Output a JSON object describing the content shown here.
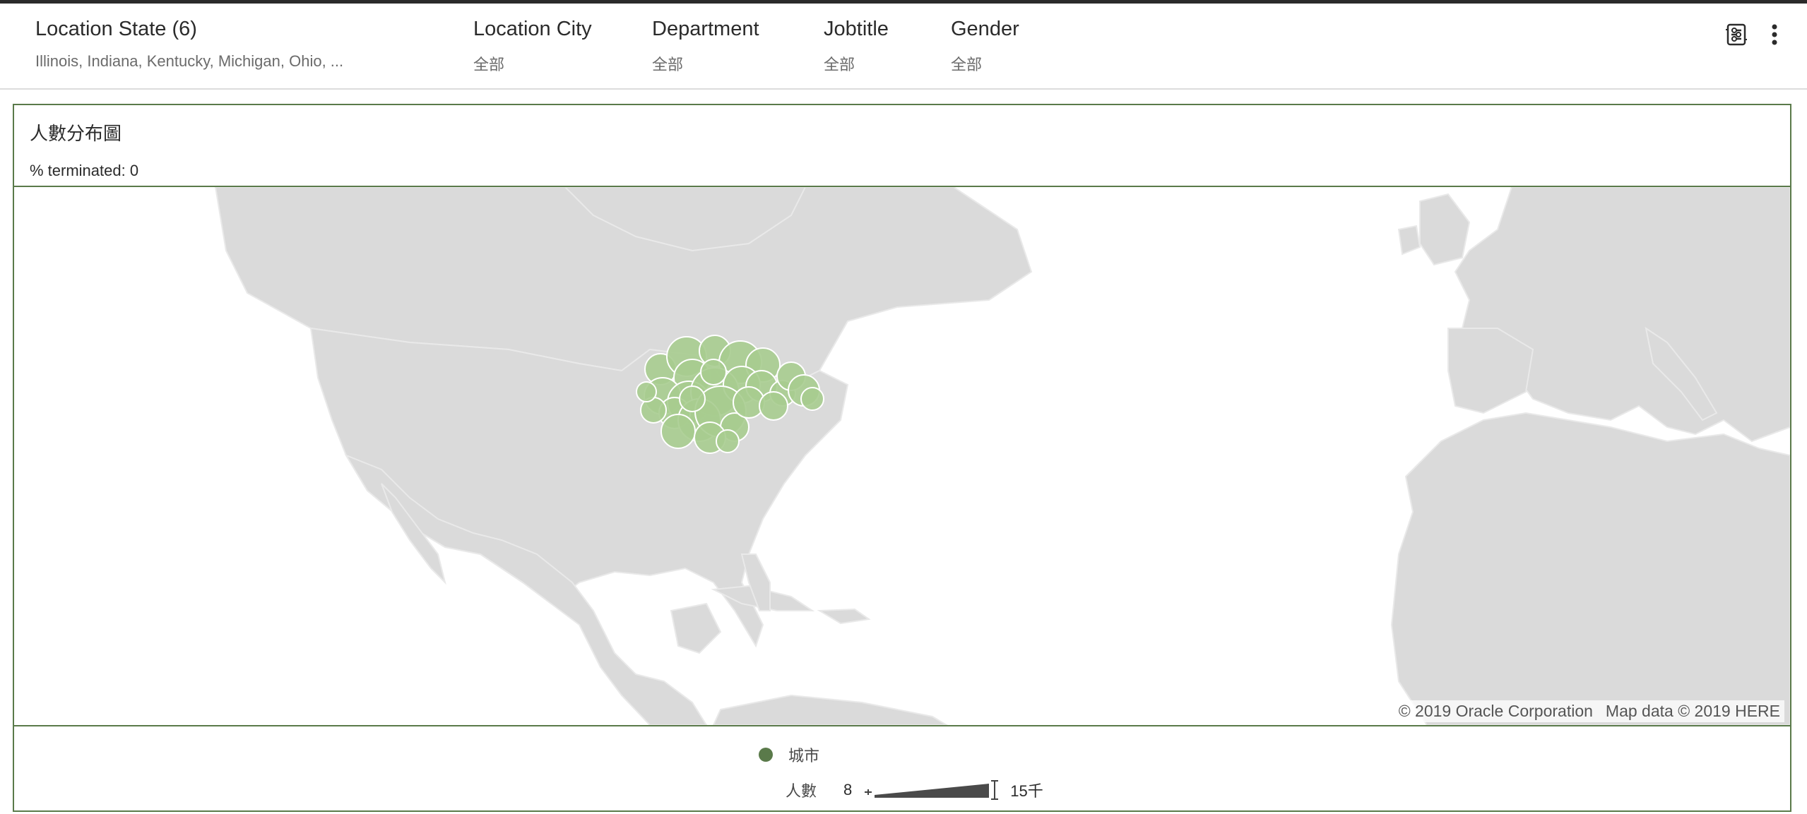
{
  "filters": [
    {
      "label": "Location State (6)",
      "value": "Illinois, Indiana, Kentucky, Michigan, Ohio, ..."
    },
    {
      "label": "Location City",
      "value": "全部"
    },
    {
      "label": "Department",
      "value": "全部"
    },
    {
      "label": "Jobtitle",
      "value": "全部"
    },
    {
      "label": "Gender",
      "value": "全部"
    }
  ],
  "icons": {
    "filter_panel": "filter-settings-icon",
    "more": "more-vertical-icon"
  },
  "panel": {
    "title": "人數分布圖",
    "subtitle_label": "% terminated:",
    "subtitle_value": "0"
  },
  "map": {
    "attribution_oracle": "© 2019 Oracle Corporation",
    "attribution_here": "Map data © 2019 HERE",
    "land_color": "#dadada",
    "bubble_fill": "#a7cc8f",
    "bubble_stroke": "#ffffff"
  },
  "legend": {
    "color_label": "城市",
    "color": "#5a7a4a",
    "size_label": "人數",
    "size_min": "8",
    "size_max": "15千"
  }
}
